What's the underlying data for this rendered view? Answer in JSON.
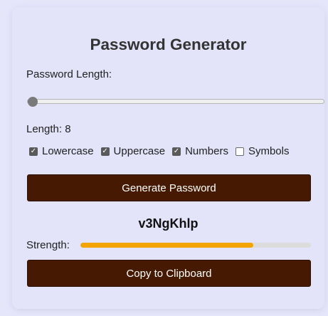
{
  "title": "Password Generator",
  "length_label": "Password Length:",
  "length_display": "Length: 8",
  "slider": {
    "value": 8,
    "min": 8,
    "max": 128
  },
  "options": [
    {
      "label": "Lowercase",
      "checked": true
    },
    {
      "label": "Uppercase",
      "checked": true
    },
    {
      "label": "Numbers",
      "checked": true
    },
    {
      "label": "Symbols",
      "checked": false
    }
  ],
  "generate_label": "Generate Password",
  "password": "v3NgKhlp",
  "strength_label": "Strength:",
  "strength": {
    "fraction": 0.75,
    "color": "#f4a400"
  },
  "copy_label": "Copy to Clipboard",
  "colors": {
    "button": "#461a02",
    "background": "#e3e3fa"
  }
}
